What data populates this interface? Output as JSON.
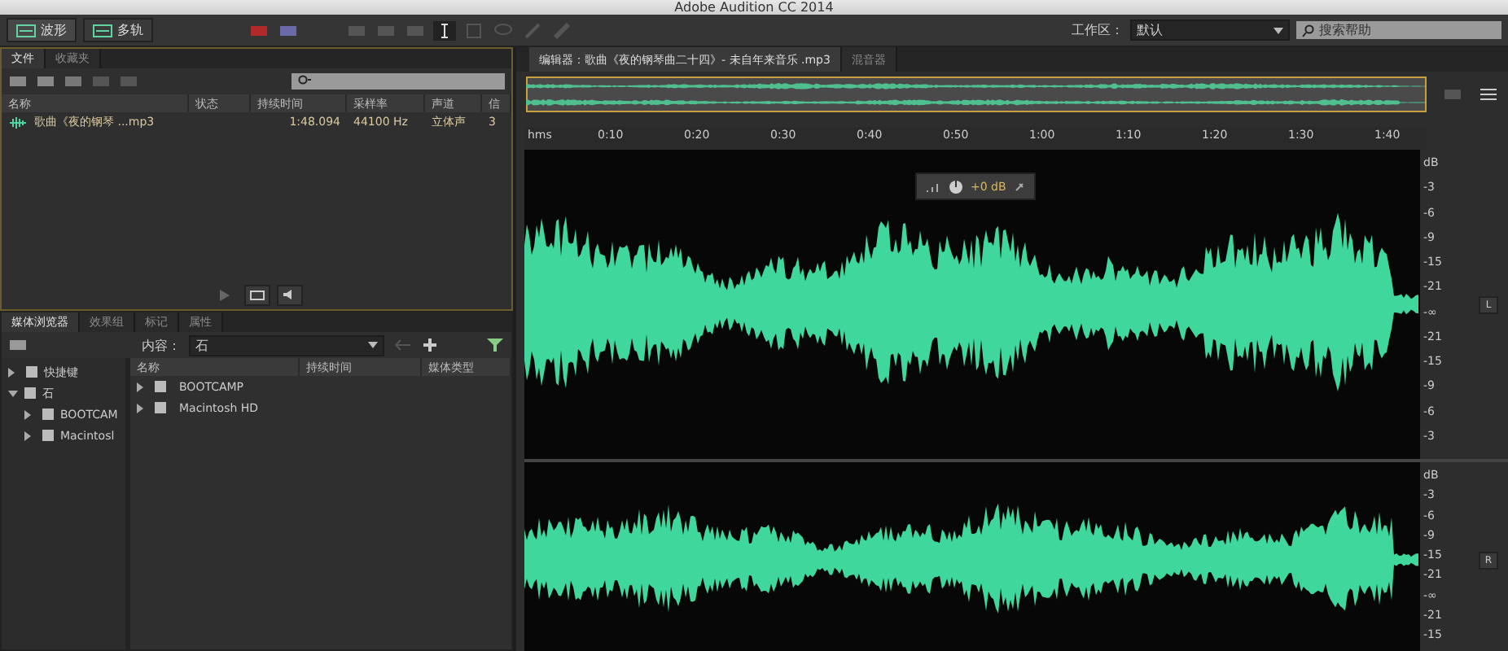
{
  "window": {
    "title": "Adobe Audition CC 2014"
  },
  "toolbar": {
    "modes": [
      {
        "label": "波形",
        "selected": true
      },
      {
        "label": "多轨",
        "selected": false
      }
    ],
    "workspace_label": "工作区：",
    "workspace_value": "默认",
    "search": {
      "placeholder": "搜索帮助"
    }
  },
  "files_panel": {
    "tabs": [
      {
        "label": "文件",
        "selected": true
      },
      {
        "label": "收藏夹",
        "selected": false
      }
    ],
    "columns": [
      "名称",
      "状态",
      "持续时间",
      "采样率",
      "声道",
      "信"
    ],
    "rows": [
      {
        "name": "歌曲《夜的钢琴 ...mp3",
        "duration": "1:48.094",
        "sample_rate": "44100 Hz",
        "channels": "立体声",
        "column_6": "3"
      }
    ]
  },
  "media_browser": {
    "tabs": [
      {
        "label": "媒体浏览器",
        "selected": true
      },
      {
        "label": "效果组",
        "selected": false
      },
      {
        "label": "标记",
        "selected": false
      },
      {
        "label": "属性",
        "selected": false
      }
    ],
    "content_label": "内容：",
    "content_value": "石",
    "tree": [
      {
        "label": "快捷键",
        "expanded": false
      },
      {
        "label": "石",
        "expanded": true,
        "children": [
          {
            "label": "BOOTCAM",
            "expanded": false
          },
          {
            "label": "Macintosl",
            "expanded": false
          }
        ]
      }
    ],
    "columns": [
      "名称",
      "持续时间",
      "媒体类型"
    ],
    "rows": [
      {
        "name": "BOOTCAMP"
      },
      {
        "name": "Macintosh HD"
      }
    ]
  },
  "editor": {
    "tabs": [
      {
        "label": "编辑器：歌曲《夜的钢琴曲二十四》- 未自年来音乐 .mp3",
        "selected": true
      },
      {
        "label": "混音器",
        "selected": false
      }
    ],
    "ruler": [
      "hms",
      "0:10",
      "0:20",
      "0:30",
      "0:40",
      "0:50",
      "1:00",
      "1:10",
      "1:20",
      "1:30",
      "1:40"
    ],
    "hud_gain": "+0 dB",
    "channels": [
      {
        "label": "L",
        "scale": [
          "dB",
          "-3",
          "-6",
          "-9",
          "-15",
          "-21",
          "-∞",
          "-21",
          "-15",
          "-9",
          "-6",
          "-3"
        ]
      },
      {
        "label": "R",
        "scale": [
          "dB",
          "-3",
          "-6",
          "-9",
          "-15",
          "-21",
          "-∞",
          "-21",
          "-15"
        ]
      }
    ]
  }
}
